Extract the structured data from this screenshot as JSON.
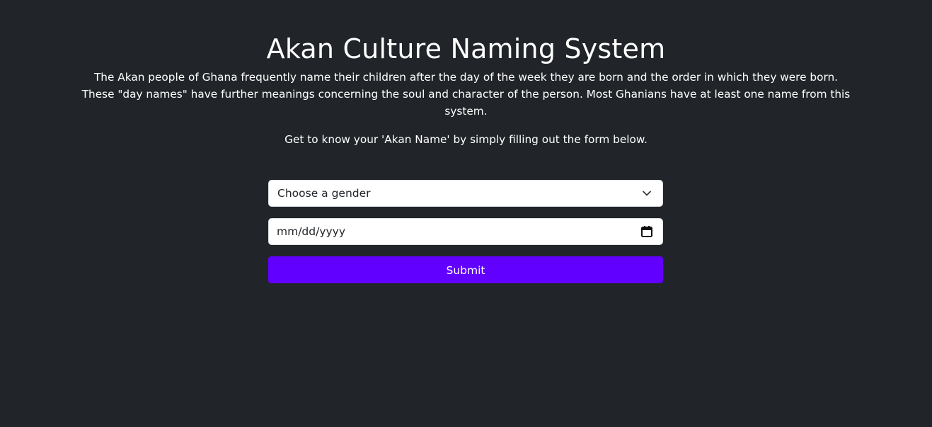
{
  "header": {
    "title": "Akan Culture Naming System",
    "intro": "The Akan people of Ghana frequently name their children after the day of the week they are born and the order in which they were born. These \"day names\" have further meanings concerning the soul and character of the person. Most Ghanians have at least one name from this system.",
    "instruction": "Get to know your 'Akan Name' by simply filling out the form below."
  },
  "form": {
    "gender_select": {
      "selected": "Choose a gender",
      "icon": "chevron-down-icon"
    },
    "date_input": {
      "placeholder": "mm/dd/yyyy",
      "icon": "calendar-icon"
    },
    "submit_label": "Submit"
  },
  "colors": {
    "background": "#212529",
    "button": "#6100ff",
    "text": "#ffffff",
    "field": "#ffffff"
  }
}
